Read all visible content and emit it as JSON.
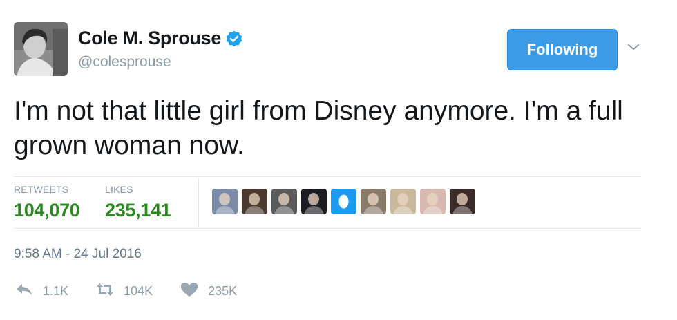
{
  "user": {
    "display_name": "Cole M. Sprouse",
    "handle": "@colesprouse",
    "verified": true,
    "avatar": "profile-photo"
  },
  "follow_button": {
    "label": "Following",
    "color": "#3b9be6"
  },
  "menu_caret": {
    "icon": "chevron-down-icon"
  },
  "tweet": {
    "text": "I'm not that little girl from Disney anymore. I'm a full grown woman now."
  },
  "stats": {
    "retweets_label": "RETWEETS",
    "retweets_value": "104,070",
    "likes_label": "LIKES",
    "likes_value": "235,141",
    "value_color": "#2a8a1f"
  },
  "likers": [
    {
      "name": "liker-avatar-1",
      "color": "#7a8aa8"
    },
    {
      "name": "liker-avatar-2",
      "color": "#4a3a30"
    },
    {
      "name": "liker-avatar-3",
      "color": "#5a5a5a"
    },
    {
      "name": "liker-avatar-4",
      "color": "#1c1c24"
    },
    {
      "name": "liker-avatar-5",
      "color": "#1d9bf0"
    },
    {
      "name": "liker-avatar-6",
      "color": "#8a7a6a"
    },
    {
      "name": "liker-avatar-7",
      "color": "#c9b89a"
    },
    {
      "name": "liker-avatar-8",
      "color": "#d8b8b0"
    },
    {
      "name": "liker-avatar-9",
      "color": "#3a2a28"
    }
  ],
  "timestamp": "9:58 AM - 24 Jul 2016",
  "actions": {
    "reply_count": "1.1K",
    "retweet_count": "104K",
    "like_count": "235K"
  }
}
